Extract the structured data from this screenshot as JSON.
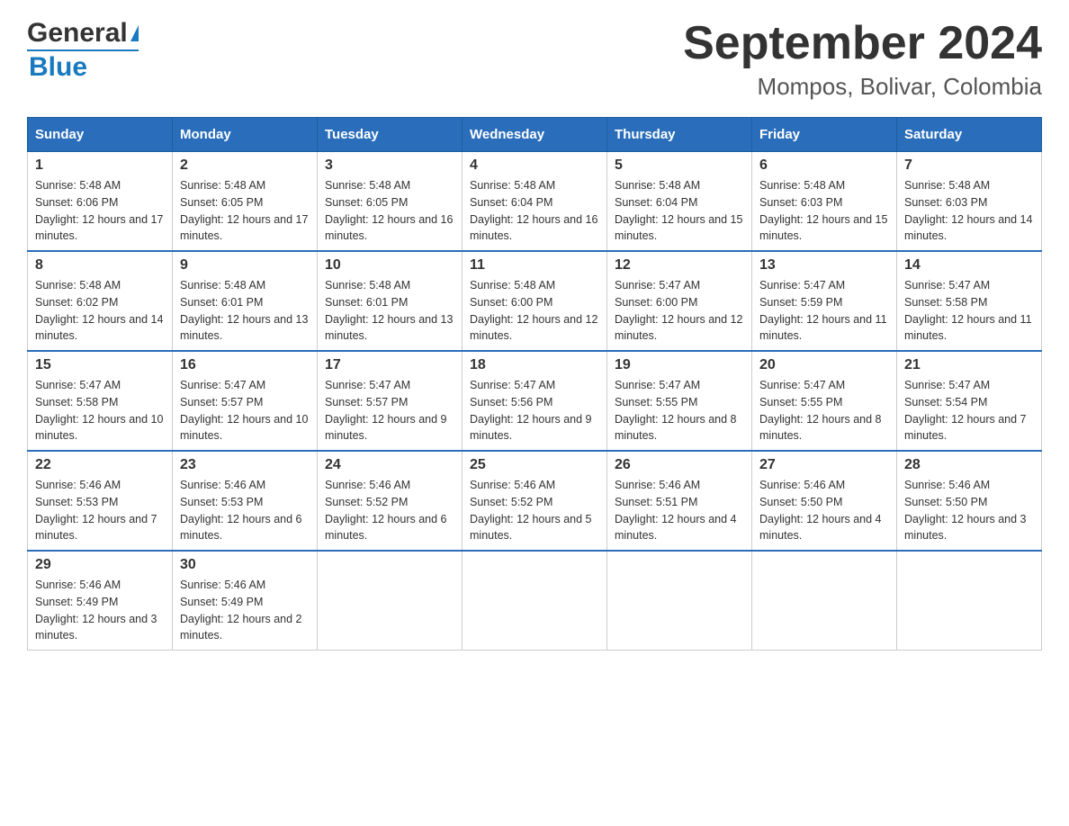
{
  "header": {
    "logo_main": "General",
    "logo_sub": "Blue",
    "main_title": "September 2024",
    "subtitle": "Mompos, Bolivar, Colombia"
  },
  "days_of_week": [
    "Sunday",
    "Monday",
    "Tuesday",
    "Wednesday",
    "Thursday",
    "Friday",
    "Saturday"
  ],
  "weeks": [
    [
      {
        "day": "1",
        "sunrise": "5:48 AM",
        "sunset": "6:06 PM",
        "daylight": "12 hours and 17 minutes."
      },
      {
        "day": "2",
        "sunrise": "5:48 AM",
        "sunset": "6:05 PM",
        "daylight": "12 hours and 17 minutes."
      },
      {
        "day": "3",
        "sunrise": "5:48 AM",
        "sunset": "6:05 PM",
        "daylight": "12 hours and 16 minutes."
      },
      {
        "day": "4",
        "sunrise": "5:48 AM",
        "sunset": "6:04 PM",
        "daylight": "12 hours and 16 minutes."
      },
      {
        "day": "5",
        "sunrise": "5:48 AM",
        "sunset": "6:04 PM",
        "daylight": "12 hours and 15 minutes."
      },
      {
        "day": "6",
        "sunrise": "5:48 AM",
        "sunset": "6:03 PM",
        "daylight": "12 hours and 15 minutes."
      },
      {
        "day": "7",
        "sunrise": "5:48 AM",
        "sunset": "6:03 PM",
        "daylight": "12 hours and 14 minutes."
      }
    ],
    [
      {
        "day": "8",
        "sunrise": "5:48 AM",
        "sunset": "6:02 PM",
        "daylight": "12 hours and 14 minutes."
      },
      {
        "day": "9",
        "sunrise": "5:48 AM",
        "sunset": "6:01 PM",
        "daylight": "12 hours and 13 minutes."
      },
      {
        "day": "10",
        "sunrise": "5:48 AM",
        "sunset": "6:01 PM",
        "daylight": "12 hours and 13 minutes."
      },
      {
        "day": "11",
        "sunrise": "5:48 AM",
        "sunset": "6:00 PM",
        "daylight": "12 hours and 12 minutes."
      },
      {
        "day": "12",
        "sunrise": "5:47 AM",
        "sunset": "6:00 PM",
        "daylight": "12 hours and 12 minutes."
      },
      {
        "day": "13",
        "sunrise": "5:47 AM",
        "sunset": "5:59 PM",
        "daylight": "12 hours and 11 minutes."
      },
      {
        "day": "14",
        "sunrise": "5:47 AM",
        "sunset": "5:58 PM",
        "daylight": "12 hours and 11 minutes."
      }
    ],
    [
      {
        "day": "15",
        "sunrise": "5:47 AM",
        "sunset": "5:58 PM",
        "daylight": "12 hours and 10 minutes."
      },
      {
        "day": "16",
        "sunrise": "5:47 AM",
        "sunset": "5:57 PM",
        "daylight": "12 hours and 10 minutes."
      },
      {
        "day": "17",
        "sunrise": "5:47 AM",
        "sunset": "5:57 PM",
        "daylight": "12 hours and 9 minutes."
      },
      {
        "day": "18",
        "sunrise": "5:47 AM",
        "sunset": "5:56 PM",
        "daylight": "12 hours and 9 minutes."
      },
      {
        "day": "19",
        "sunrise": "5:47 AM",
        "sunset": "5:55 PM",
        "daylight": "12 hours and 8 minutes."
      },
      {
        "day": "20",
        "sunrise": "5:47 AM",
        "sunset": "5:55 PM",
        "daylight": "12 hours and 8 minutes."
      },
      {
        "day": "21",
        "sunrise": "5:47 AM",
        "sunset": "5:54 PM",
        "daylight": "12 hours and 7 minutes."
      }
    ],
    [
      {
        "day": "22",
        "sunrise": "5:46 AM",
        "sunset": "5:53 PM",
        "daylight": "12 hours and 7 minutes."
      },
      {
        "day": "23",
        "sunrise": "5:46 AM",
        "sunset": "5:53 PM",
        "daylight": "12 hours and 6 minutes."
      },
      {
        "day": "24",
        "sunrise": "5:46 AM",
        "sunset": "5:52 PM",
        "daylight": "12 hours and 6 minutes."
      },
      {
        "day": "25",
        "sunrise": "5:46 AM",
        "sunset": "5:52 PM",
        "daylight": "12 hours and 5 minutes."
      },
      {
        "day": "26",
        "sunrise": "5:46 AM",
        "sunset": "5:51 PM",
        "daylight": "12 hours and 4 minutes."
      },
      {
        "day": "27",
        "sunrise": "5:46 AM",
        "sunset": "5:50 PM",
        "daylight": "12 hours and 4 minutes."
      },
      {
        "day": "28",
        "sunrise": "5:46 AM",
        "sunset": "5:50 PM",
        "daylight": "12 hours and 3 minutes."
      }
    ],
    [
      {
        "day": "29",
        "sunrise": "5:46 AM",
        "sunset": "5:49 PM",
        "daylight": "12 hours and 3 minutes."
      },
      {
        "day": "30",
        "sunrise": "5:46 AM",
        "sunset": "5:49 PM",
        "daylight": "12 hours and 2 minutes."
      },
      null,
      null,
      null,
      null,
      null
    ]
  ]
}
